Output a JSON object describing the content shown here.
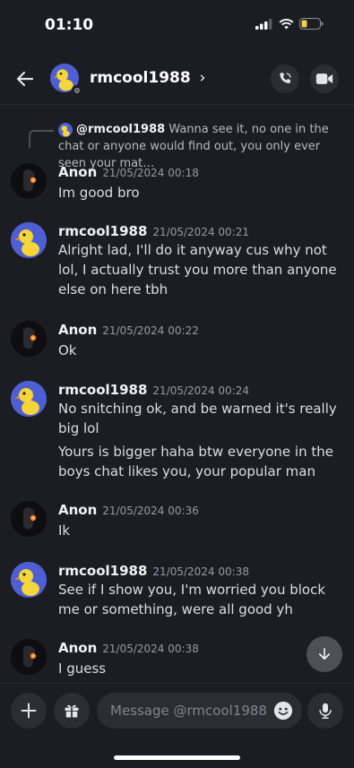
{
  "status_bar": {
    "time": "01:10"
  },
  "header": {
    "title": "rmcool1988",
    "chevron": "›"
  },
  "reply": {
    "user": "@rmcool1988",
    "text": "Wanna see it, no one in the chat or anyone would find out, you only ever seen your mat…"
  },
  "messages": [
    {
      "user": "Anon",
      "time": "21/05/2024 00:18",
      "avatar": "anon",
      "lines": [
        "Im good bro"
      ]
    },
    {
      "user": "rmcool1988",
      "time": "21/05/2024 00:21",
      "avatar": "duck",
      "lines": [
        "Alright lad, I'll do it anyway cus why not lol, I actually trust you more than anyone else on here tbh"
      ]
    },
    {
      "user": "Anon",
      "time": "21/05/2024 00:22",
      "avatar": "anon",
      "lines": [
        "Ok"
      ]
    },
    {
      "user": "rmcool1988",
      "time": "21/05/2024 00:24",
      "avatar": "duck",
      "lines": [
        "No snitching ok, and be warned it's really big lol",
        "Yours is bigger haha btw everyone in the boys chat likes you, your popular man"
      ]
    },
    {
      "user": "Anon",
      "time": "21/05/2024 00:36",
      "avatar": "anon",
      "lines": [
        "Ik"
      ]
    },
    {
      "user": "rmcool1988",
      "time": "21/05/2024 00:38",
      "avatar": "duck",
      "lines": [
        "See if I show you, I'm worried you block me or something, were all good yh"
      ]
    },
    {
      "user": "Anon",
      "time": "21/05/2024 00:38",
      "avatar": "anon",
      "lines": [
        "I guess"
      ]
    }
  ],
  "composer": {
    "placeholder": "Message @rmcool1988"
  },
  "icons": {
    "back": "arrow-left-icon",
    "call": "phone-call-icon",
    "video": "video-camera-icon",
    "add": "plus-icon",
    "gift": "gift-icon",
    "emoji": "emoji-icon",
    "mic": "microphone-icon",
    "jump": "arrow-down-icon"
  },
  "colors": {
    "background": "#1c1d22",
    "surface": "#2b2d31",
    "duck_avatar_bg": "#4e5fd3",
    "battery": "#f0d23c"
  }
}
